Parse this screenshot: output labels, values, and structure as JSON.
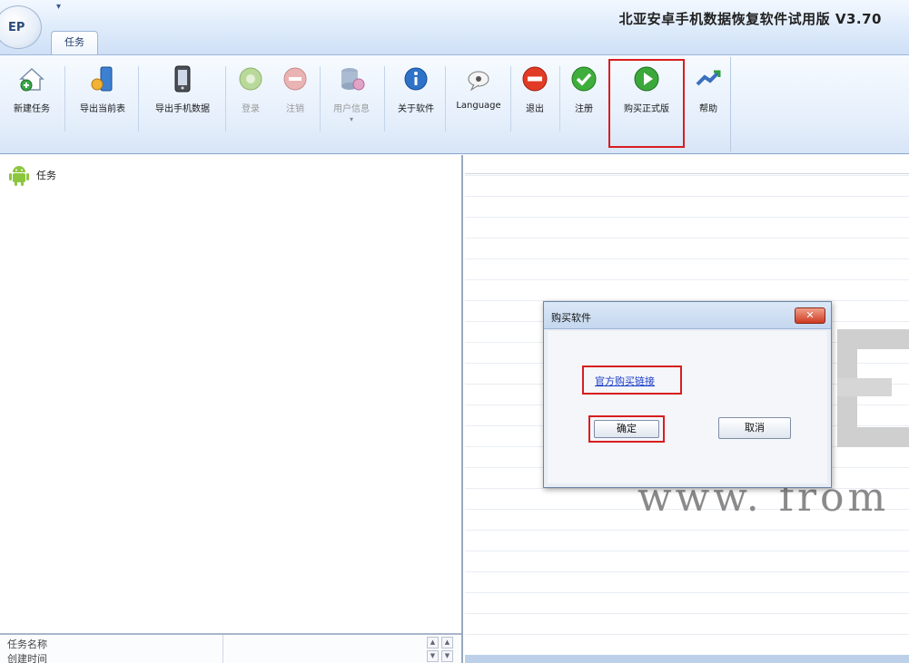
{
  "window": {
    "title": "北亚安卓手机数据恢复软件试用版 V3.70",
    "orb_label": "EP",
    "quick_access_glyph": "▾"
  },
  "tabs": [
    {
      "label": "任务",
      "active": true
    }
  ],
  "ribbon": {
    "buttons": [
      {
        "label": "新建任务",
        "icon": "new-task-icon",
        "enabled": true
      },
      {
        "label": "导出当前表",
        "icon": "export-table-icon",
        "enabled": true
      },
      {
        "label": "导出手机数据",
        "icon": "export-phone-data-icon",
        "enabled": true
      },
      {
        "label": "登录",
        "icon": "login-icon",
        "enabled": false
      },
      {
        "label": "注销",
        "icon": "logout-icon",
        "enabled": false
      },
      {
        "label": "用户信息",
        "icon": "user-info-icon",
        "enabled": false
      },
      {
        "label": "关于软件",
        "icon": "about-icon",
        "enabled": true
      },
      {
        "label": "Language",
        "icon": "language-icon",
        "enabled": true
      },
      {
        "label": "退出",
        "icon": "exit-icon",
        "enabled": true
      },
      {
        "label": "注册",
        "icon": "register-icon",
        "enabled": true
      },
      {
        "label": "购买正式版",
        "icon": "buy-icon",
        "enabled": true,
        "highlighted": true
      },
      {
        "label": "帮助",
        "icon": "help-icon",
        "enabled": true
      }
    ],
    "user_info_dropdown_glyph": "▾"
  },
  "tree": {
    "root_label": "任务",
    "root_icon": "android-icon"
  },
  "properties": {
    "rows": [
      "任务名称",
      "创建时间"
    ],
    "scroll_up": "▲",
    "scroll_down": "▼"
  },
  "watermark": {
    "url_text": "www. from"
  },
  "dialog": {
    "title": "购买软件",
    "close_glyph": "✕",
    "link_text": "官方购买链接",
    "ok_label": "确定",
    "cancel_label": "取消"
  },
  "colors": {
    "highlight_red": "#d81e1e",
    "ribbon_blue": "#dbe9fa",
    "link_blue": "#1a3cc7"
  }
}
